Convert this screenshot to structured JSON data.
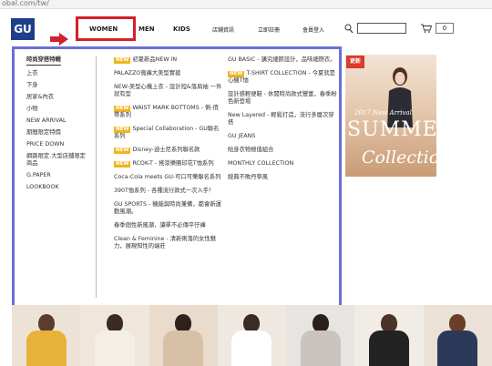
{
  "browser": {
    "url": "obal.com/tw/"
  },
  "header": {
    "logo": "GU",
    "nav": {
      "women": "WOMEN",
      "men": "MEN",
      "kids": "KIDS",
      "stores": "店鋪資訊",
      "register": "立即註冊",
      "login": "會員登入"
    },
    "search": {
      "value": ""
    },
    "cart": {
      "count": "0"
    }
  },
  "dropdown": {
    "categories": [
      "時尚穿搭特輯",
      "上衣",
      "下身",
      "居家&內衣",
      "小物",
      "NEW ARRIVAL",
      "期間限定特價",
      "PRICE DOWN",
      "網路限定.大型店舖限定商品",
      "G.PAPER",
      "LOOKBOOK"
    ],
    "new_badge": "NEW",
    "middle": [
      {
        "text": "初夏新品NEW IN",
        "new": true
      },
      {
        "text": "PALAZZO寬褲大美型實搶",
        "new": false
      },
      {
        "text": "NEW-美型心機上衣 - 設計短&落肩袖 一件就有型",
        "new": false
      },
      {
        "text": "WAIST MARK BOTTOMS - 俐-俏帶系列",
        "new": true
      },
      {
        "text": "Special Collaboration - GU聯名系列",
        "new": true
      },
      {
        "text": "Disney-迪士尼系列聯名款",
        "new": true
      },
      {
        "text": "RCOK-T - 搖滾樂團印花T恤系列",
        "new": true
      },
      {
        "text": "Coca-Cola meets GU-可口可樂聯名系列",
        "new": false
      },
      {
        "text": "390T恤系列 - 各種流行款式一次入手！",
        "new": false
      },
      {
        "text": "GU SPORTS - 機能與時尚兼備，都會新運動風潮。",
        "new": false
      },
      {
        "text": "春季個性新風潮，讓單不必傳平仔褲",
        "new": false
      },
      {
        "text": "Clean & Feminine - 清新俐落的女性魅力，展現知性的端莊",
        "new": false
      }
    ],
    "right": [
      {
        "text": "GU BASIC - 講究細節設計，品味細簡衣。",
        "new": false
      },
      {
        "text": "T-SHIRT COLLECTION - 今夏就是心機T恤",
        "new": true
      },
      {
        "text": "設計感輕便鞋 - 休閒時尚款式豐富，春季粉色新登場",
        "new": false
      },
      {
        "text": "New Layered - 輕鬆打造，流行多層次穿搭",
        "new": false
      },
      {
        "text": "GU JEANS",
        "new": false
      },
      {
        "text": "貼身衣物極值組合",
        "new": false
      },
      {
        "text": "MONTHLY COLLECTION",
        "new": false
      },
      {
        "text": "經典不敗丹寧風",
        "new": false
      }
    ]
  },
  "banner": {
    "badge": "更新",
    "small_text": "2017 New Arrival",
    "big_text": "SUMMER",
    "script_text": "Collection"
  },
  "colors": {
    "brand": "#1d3f8a",
    "highlight_red": "#d3202a",
    "highlight_blue": "#6a6fd6",
    "new_badge": "#f0b51e"
  }
}
